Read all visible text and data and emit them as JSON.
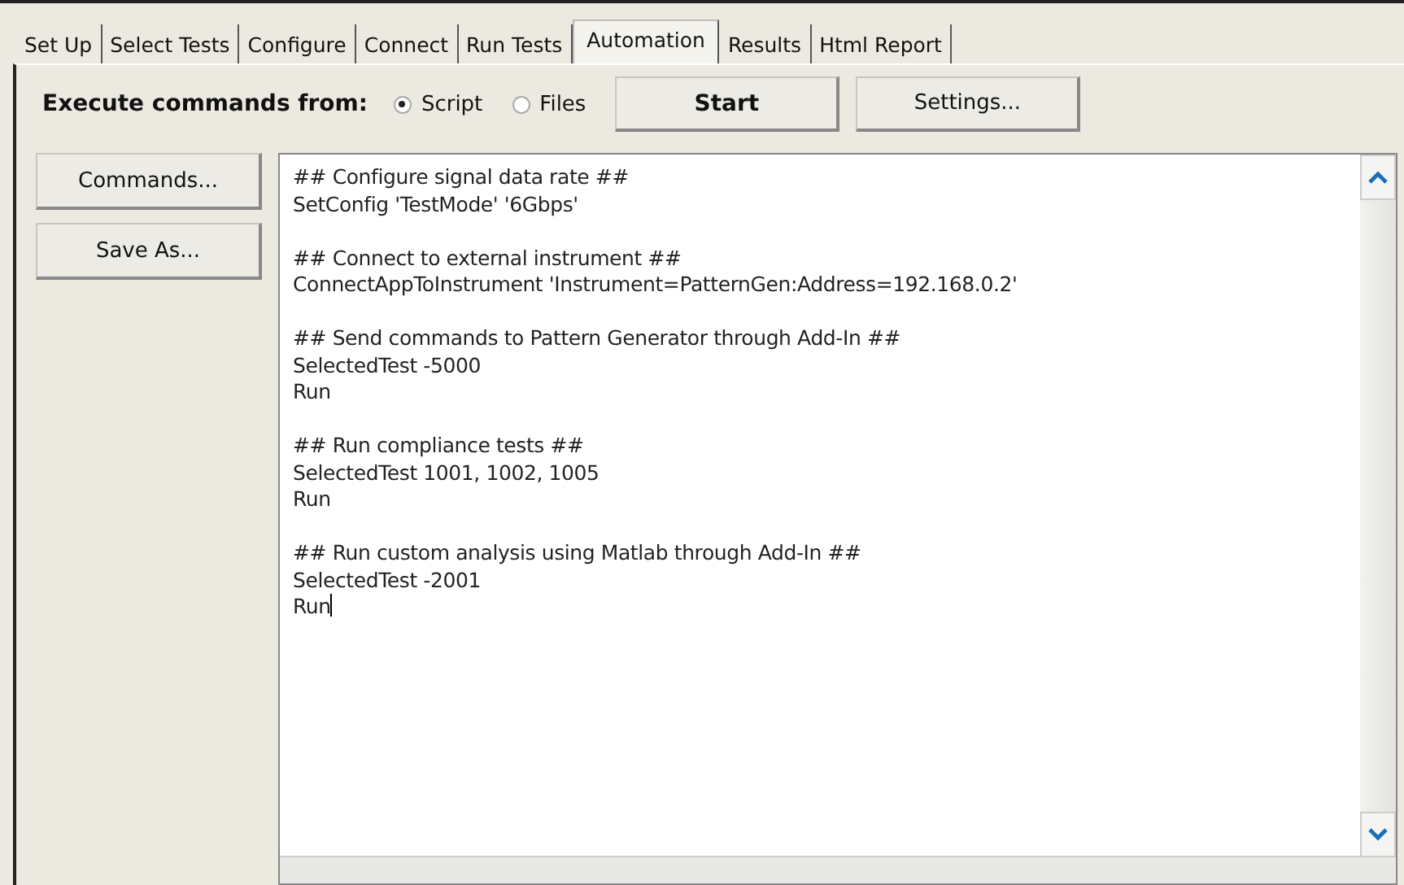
{
  "tabs": [
    {
      "label": "Set Up",
      "selected": false
    },
    {
      "label": "Select Tests",
      "selected": false
    },
    {
      "label": "Configure",
      "selected": false
    },
    {
      "label": "Connect",
      "selected": false
    },
    {
      "label": "Run Tests",
      "selected": false
    },
    {
      "label": "Automation",
      "selected": true
    },
    {
      "label": "Results",
      "selected": false
    },
    {
      "label": "Html Report",
      "selected": false
    }
  ],
  "toolbar": {
    "label": "Execute commands from:",
    "sources": [
      {
        "label": "Script",
        "selected": true
      },
      {
        "label": "Files",
        "selected": false
      }
    ],
    "buttons": [
      "Start",
      "Settings..."
    ]
  },
  "side_buttons": [
    "Commands...",
    "Save As..."
  ],
  "script": [
    [
      "## Configure signal data rate ##",
      "SetConfig 'TestMode' '6Gbps'"
    ],
    [
      "## Connect to external instrument ##",
      "ConnectAppToInstrument 'Instrument=PatternGen:Address=192.168.0.2'"
    ],
    [
      "## Send commands to Pattern Generator through Add-In ##",
      "SelectedTest -5000",
      "Run"
    ],
    [
      "## Run compliance tests ##",
      "SelectedTest 1001, 1002, 1005",
      "Run"
    ],
    [
      "## Run custom analysis using Matlab through Add-In ##",
      "SelectedTest -2001",
      "Run"
    ]
  ]
}
